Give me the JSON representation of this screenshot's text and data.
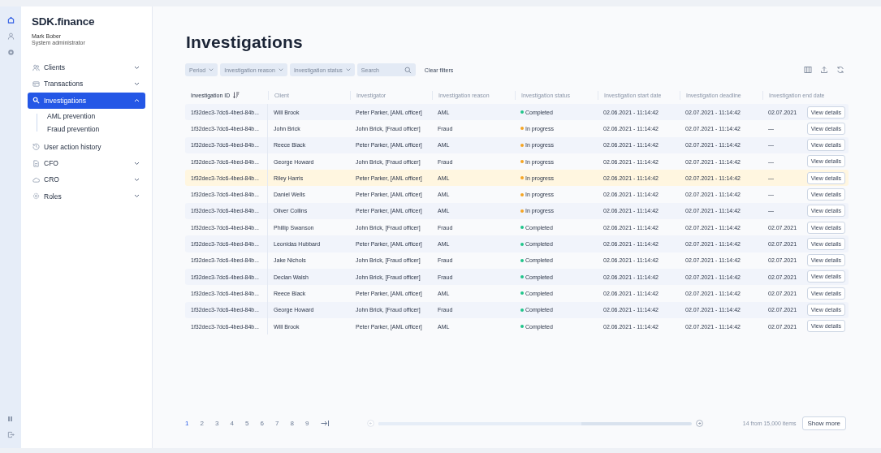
{
  "rail": {
    "top": [
      {
        "selected": true
      },
      {
        "selected": false
      },
      {
        "selected": false
      }
    ]
  },
  "brand": "SDK.finance",
  "user": {
    "name": "Mark Bober",
    "role": "System administrator"
  },
  "nav": [
    {
      "label": "Clients",
      "selected": false,
      "expanded": false
    },
    {
      "label": "Transactions",
      "selected": false,
      "expanded": false
    },
    {
      "label": "Investigations",
      "selected": true,
      "expanded": true,
      "children": [
        {
          "label": "AML prevention"
        },
        {
          "label": "Fraud prevention"
        }
      ]
    },
    {
      "label": "User action history",
      "selected": false
    },
    {
      "label": "CFO",
      "selected": false,
      "expanded": false
    },
    {
      "label": "CRO",
      "selected": false,
      "expanded": false
    },
    {
      "label": "Roles",
      "selected": false,
      "expanded": false
    }
  ],
  "title": "Investigations",
  "filters": [
    {
      "label": "Period"
    },
    {
      "label": "Investigation reason"
    },
    {
      "label": "Investigation status"
    }
  ],
  "search": {
    "placeholder": "Search"
  },
  "clear_filters": "Clear filters",
  "table": {
    "columns": [
      "Investigation ID",
      "Client",
      "Investigator",
      "Investigation reason",
      "Investigation status",
      "Investigation start date",
      "Investigation deadline",
      "Investigation end date"
    ],
    "rows": [
      {
        "id": "1f32dec3-7dc6-4bed-84b...",
        "client": "Will Brook",
        "investigator": "Peter Parker, [AML officer]",
        "reason": "AML",
        "status": "Completed",
        "color": "#22c58b",
        "start": "02.06.2021 - 11:14:42",
        "deadline": "02.07.2021 - 11:14:42",
        "end": "02.07.2021",
        "action": "View details",
        "selected": false
      },
      {
        "id": "1f32dec3-7dc6-4bed-84b...",
        "client": "John Brick",
        "investigator": "John Brick, [Fraud officer]",
        "reason": "Fraud",
        "status": "In progress",
        "color": "#f5a524",
        "start": "02.06.2021 - 11:14:42",
        "deadline": "02.07.2021 - 11:14:42",
        "end": "—",
        "action": "View details",
        "selected": false
      },
      {
        "id": "1f32dec3-7dc6-4bed-84b...",
        "client": "Reece Black",
        "investigator": "Peter Parker, [AML officer]",
        "reason": "AML",
        "status": "In progress",
        "color": "#f5a524",
        "start": "02.06.2021 - 11:14:42",
        "deadline": "02.07.2021 - 11:14:42",
        "end": "—",
        "action": "View details",
        "selected": false
      },
      {
        "id": "1f32dec3-7dc6-4bed-84b...",
        "client": "George Howard",
        "investigator": "John Brick, [Fraud officer]",
        "reason": "Fraud",
        "status": "In progress",
        "color": "#f5a524",
        "start": "02.06.2021 - 11:14:42",
        "deadline": "02.07.2021 - 11:14:42",
        "end": "—",
        "action": "View details",
        "selected": false
      },
      {
        "id": "1f32dec3-7dc6-4bed-84b...",
        "client": "Riley Harris",
        "investigator": "Peter Parker, [AML officer]",
        "reason": "AML",
        "status": "In progress",
        "color": "#f5a524",
        "start": "02.06.2021 - 11:14:42",
        "deadline": "02.07.2021 - 11:14:42",
        "end": "—",
        "action": "View details",
        "selected": true
      },
      {
        "id": "1f32dec3-7dc6-4bed-84b...",
        "client": "Daniel Wells",
        "investigator": "Peter Parker, [AML officer]",
        "reason": "AML",
        "status": "In progress",
        "color": "#f5a524",
        "start": "02.06.2021 - 11:14:42",
        "deadline": "02.07.2021 - 11:14:42",
        "end": "—",
        "action": "View details",
        "selected": false
      },
      {
        "id": "1f32dec3-7dc6-4bed-84b...",
        "client": "Oliver Collins",
        "investigator": "Peter Parker, [AML officer]",
        "reason": "AML",
        "status": "In progress",
        "color": "#f5a524",
        "start": "02.06.2021 - 11:14:42",
        "deadline": "02.07.2021 - 11:14:42",
        "end": "—",
        "action": "View details",
        "selected": false
      },
      {
        "id": "1f32dec3-7dc6-4bed-84b...",
        "client": "Phillip Swanson",
        "investigator": "John Brick, [Fraud officer]",
        "reason": "Fraud",
        "status": "Completed",
        "color": "#22c58b",
        "start": "02.06.2021 - 11:14:42",
        "deadline": "02.07.2021 - 11:14:42",
        "end": "02.07.2021",
        "action": "View details",
        "selected": false
      },
      {
        "id": "1f32dec3-7dc6-4bed-84b...",
        "client": "Leonidas Hubbard",
        "investigator": "Peter Parker, [AML officer]",
        "reason": "AML",
        "status": "Completed",
        "color": "#22c58b",
        "start": "02.06.2021 - 11:14:42",
        "deadline": "02.07.2021 - 11:14:42",
        "end": "02.07.2021",
        "action": "View details",
        "selected": false
      },
      {
        "id": "1f32dec3-7dc6-4bed-84b...",
        "client": "Jake Nichols",
        "investigator": "John Brick, [Fraud officer]",
        "reason": "Fraud",
        "status": "Completed",
        "color": "#22c58b",
        "start": "02.06.2021 - 11:14:42",
        "deadline": "02.07.2021 - 11:14:42",
        "end": "02.07.2021",
        "action": "View details",
        "selected": false
      },
      {
        "id": "1f32dec3-7dc6-4bed-84b...",
        "client": "Declan Walsh",
        "investigator": "John Brick, [Fraud officer]",
        "reason": "Fraud",
        "status": "Completed",
        "color": "#22c58b",
        "start": "02.06.2021 - 11:14:42",
        "deadline": "02.07.2021 - 11:14:42",
        "end": "02.07.2021",
        "action": "View details",
        "selected": false
      },
      {
        "id": "1f32dec3-7dc6-4bed-84b...",
        "client": "Reece Black",
        "investigator": "Peter Parker, [AML officer]",
        "reason": "AML",
        "status": "Completed",
        "color": "#22c58b",
        "start": "02.06.2021 - 11:14:42",
        "deadline": "02.07.2021 - 11:14:42",
        "end": "02.07.2021",
        "action": "View details",
        "selected": false
      },
      {
        "id": "1f32dec3-7dc6-4bed-84b...",
        "client": "George Howard",
        "investigator": "John Brick, [Fraud officer]",
        "reason": "Fraud",
        "status": "Completed",
        "color": "#22c58b",
        "start": "02.06.2021 - 11:14:42",
        "deadline": "02.07.2021 - 11:14:42",
        "end": "02.07.2021",
        "action": "View details",
        "selected": false
      },
      {
        "id": "1f32dec3-7dc6-4bed-84b...",
        "client": "Will Brook",
        "investigator": "Peter Parker, [AML officer]",
        "reason": "AML",
        "status": "Completed",
        "color": "#22c58b",
        "start": "02.06.2021 - 11:14:42",
        "deadline": "02.07.2021 - 11:14:42",
        "end": "02.07.2021",
        "action": "View details",
        "selected": false
      }
    ]
  },
  "pagination": {
    "pages": [
      {
        "label": "1",
        "selected": true
      },
      {
        "label": "2",
        "selected": false
      },
      {
        "label": "3",
        "selected": false
      },
      {
        "label": "4",
        "selected": false
      },
      {
        "label": "5",
        "selected": false
      },
      {
        "label": "6",
        "selected": false
      },
      {
        "label": "7",
        "selected": false
      },
      {
        "label": "8",
        "selected": false
      },
      {
        "label": "9",
        "selected": false
      }
    ]
  },
  "item_count": "14 from 15,000 items",
  "show_more": "Show more"
}
